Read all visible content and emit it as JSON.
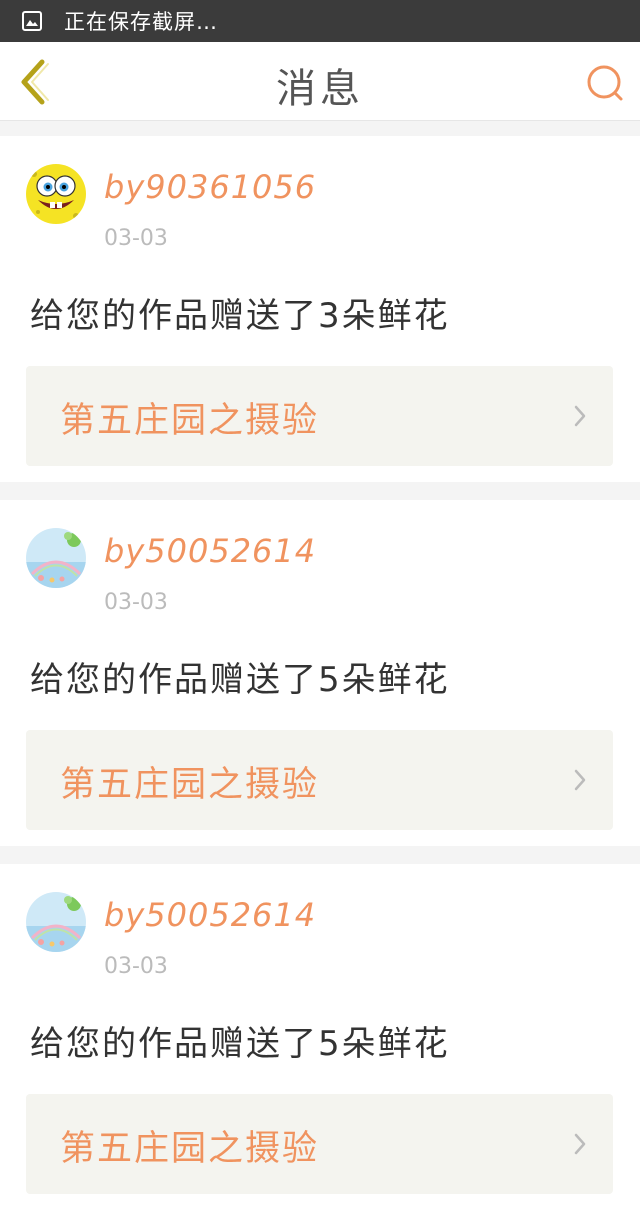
{
  "status_bar": {
    "text": "正在保存截屏…",
    "icon": "image-icon"
  },
  "header": {
    "title": "消息",
    "back_icon": "chevron-left-icon",
    "search_icon": "search-icon"
  },
  "colors": {
    "accent": "#f0935f",
    "back_arrow": "#b5a21a",
    "card_link_bg": "#f4f4ef",
    "page_bg": "#f4f4f4"
  },
  "messages": [
    {
      "username": "by90361056",
      "date": "03-03",
      "message": "给您的作品赠送了3朵鲜花",
      "work_title": "第五庄园之摄验",
      "avatar": "spongebob-avatar"
    },
    {
      "username": "by50052614",
      "date": "03-03",
      "message": "给您的作品赠送了5朵鲜花",
      "work_title": "第五庄园之摄验",
      "avatar": "landscape-avatar"
    },
    {
      "username": "by50052614",
      "date": "03-03",
      "message": "给您的作品赠送了5朵鲜花",
      "work_title": "第五庄园之摄验",
      "avatar": "landscape-avatar"
    }
  ]
}
